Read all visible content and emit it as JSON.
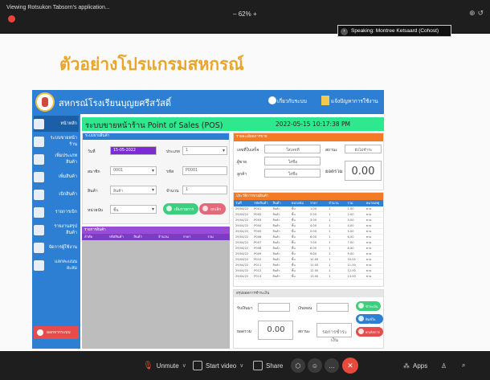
{
  "zoom": {
    "window_title": "Viewing Rotsukon Tabsorn's application...",
    "zoom_level": "62%",
    "zoom_plus": "+",
    "speaking_label": "Speaking: Montree Ketsaard (Cohost)",
    "bottom": {
      "unmute": "Unmute",
      "start_video": "Start video",
      "share": "Share",
      "apps": "Apps"
    },
    "colors": {
      "leave": "#e74a3b",
      "record": "#e8443a"
    }
  },
  "slide": {
    "title": "ตัวอย่างโปรแกรมสหกรณ์"
  },
  "app": {
    "org_name": "สหกรณ์โรงเรียนบุญยศรีสวัสดิ์",
    "about": "เกี่ยวกับระบบ",
    "manual": "แจ้งปัญหาการใช้งาน",
    "sidebar": [
      "หน้าหลัก",
      "ระบบขายหน้าร้าน",
      "เพิ่มประเภทสินค้า",
      "เพิ่มสินค้า",
      "เบิกสินค้า",
      "รายการเบิก",
      "รายงานสรุปสินค้า",
      "จัดการผู้ใช้งาน",
      "แลกคะแนนสะสม"
    ],
    "exit": "ออกจากระบบ",
    "pos_title": "ระบบขายหน้าร้าน Point of Sales (POS)",
    "datetime": "2022-05-15 10:17:38 PM",
    "form": {
      "header": "ระบบขายสินค้า",
      "label_date": "วันที่",
      "date_value": "15-05-2022",
      "label_type": "ประเภท",
      "type_value": "1",
      "label_member": "สมาชิก",
      "member_value": "0001",
      "label_code": "รหัส",
      "code_value": "P0001",
      "label_item": "สินค้า",
      "item_value": "สินค้า",
      "label_qty": "จำนวน",
      "qty_value": "1",
      "label_unit": "หน่วยนับ",
      "unit_value": "ชิ้น",
      "label_price": "ราคา",
      "price_value": "120",
      "btn_add": "เพิ่มรายการ",
      "btn_cancel": "ยกเลิก"
    },
    "cart": {
      "header": "รายการสินค้า",
      "cols": [
        "ลำดับ",
        "รหัสสินค้า",
        "สินค้า",
        "จำนวน",
        "ราคา",
        "รวม"
      ]
    },
    "summary": {
      "header": "รายละเอียดการขาย",
      "label_receipt": "เลขที่ใบเสร็จ",
      "receipt_value": "ใส่เลขที่",
      "label_cashier": "ผู้ขาย",
      "cashier_value": "ใส่ชื่อ",
      "label_customer": "ลูกค้า",
      "customer_value": "ใส่ชื่อ",
      "label_date2": "วันที่",
      "date2_value": "ใส่วันที่",
      "label_status": "สถานะ",
      "status_value": "ยังไม่ชำระ",
      "label_total": "ยอดรวม",
      "total": "0.00"
    },
    "history": {
      "header": "ประวัติการขายสินค้า",
      "cols": [
        "วันที่",
        "รหัสสินค้า",
        "สินค้า",
        "หน่วยนับ",
        "ราคา",
        "จำนวน",
        "รวม",
        "หมายเหตุ"
      ],
      "rows": [
        [
          "29/04/22",
          "P001",
          "สินค้า",
          "ชิ้น",
          "1.00",
          "1",
          "1.00",
          "ขาย"
        ],
        [
          "29/04/22",
          "P002",
          "สินค้า",
          "ชิ้น",
          "2.00",
          "1",
          "2.00",
          "ขาย"
        ],
        [
          "29/04/22",
          "P003",
          "สินค้า",
          "ชิ้น",
          "3.00",
          "1",
          "3.00",
          "ขาย"
        ],
        [
          "29/04/22",
          "P004",
          "สินค้า",
          "ชิ้น",
          "4.00",
          "1",
          "4.00",
          "ขาย"
        ],
        [
          "29/04/22",
          "P005",
          "สินค้า",
          "ชิ้น",
          "5.00",
          "1",
          "5.00",
          "ขาย"
        ],
        [
          "29/04/22",
          "P006",
          "สินค้า",
          "ชิ้น",
          "6.00",
          "1",
          "6.00",
          "ขาย"
        ],
        [
          "29/04/22",
          "P007",
          "สินค้า",
          "ชิ้น",
          "7.00",
          "1",
          "7.00",
          "ขาย"
        ],
        [
          "29/04/22",
          "P008",
          "สินค้า",
          "ชิ้น",
          "8.00",
          "1",
          "8.00",
          "ขาย"
        ],
        [
          "29/04/22",
          "P009",
          "สินค้า",
          "ชิ้น",
          "9.00",
          "1",
          "9.00",
          "ขาย"
        ],
        [
          "29/04/22",
          "P010",
          "สินค้า",
          "ชิ้น",
          "10.00",
          "1",
          "10.00",
          "ขาย"
        ],
        [
          "29/04/22",
          "P011",
          "สินค้า",
          "ชิ้น",
          "11.00",
          "1",
          "11.00",
          "ขาย"
        ],
        [
          "29/04/22",
          "P012",
          "สินค้า",
          "ชิ้น",
          "12.00",
          "1",
          "12.00",
          "ขาย"
        ],
        [
          "29/04/22",
          "P013",
          "สินค้า",
          "ชิ้น",
          "13.00",
          "1",
          "13.00",
          "ขาย"
        ]
      ]
    },
    "payment": {
      "header": "สรุปยอดการชำระเงิน",
      "label_received": "รับเงินมา",
      "label_change": "เงินทอน",
      "label_total": "ยอดรวม",
      "total": "0.00",
      "label_status": "สถานะ",
      "status_value": "รอการชำระเงิน",
      "btn_pay": "ชำระเงิน",
      "btn_print": "พิมพ์ใบเสร็จ",
      "btn_cancel": "ยกเลิกการขาย"
    }
  }
}
